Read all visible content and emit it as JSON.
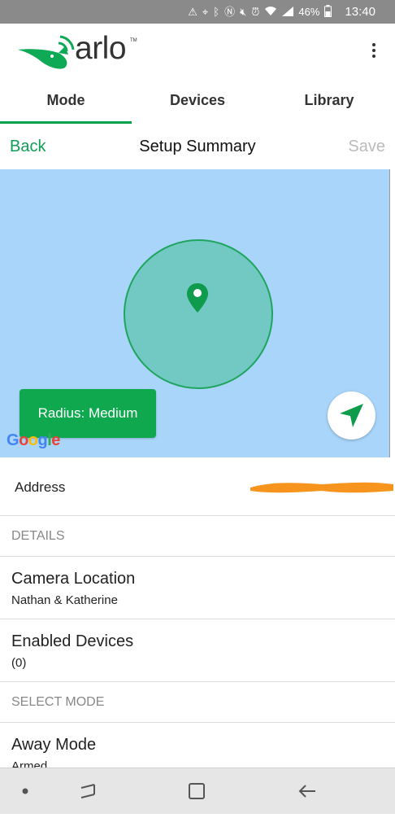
{
  "status_bar": {
    "battery_percent": "46%",
    "time": "13:40",
    "icons": [
      "warning-icon",
      "location-icon",
      "bluetooth-icon",
      "nfc-icon",
      "mute-icon",
      "alarm-icon",
      "wifi-icon",
      "signal-icon",
      "battery-icon"
    ]
  },
  "app": {
    "logo_text": "arlo",
    "logo_trademark": "TM",
    "menu_icon": "more-vert-icon",
    "brand_color": "#00a04a"
  },
  "tabs": [
    {
      "label": "Mode",
      "active": true
    },
    {
      "label": "Devices",
      "active": false
    },
    {
      "label": "Library",
      "active": false
    }
  ],
  "nav": {
    "back_label": "Back",
    "title": "Setup Summary",
    "save_label": "Save"
  },
  "map": {
    "radius_label": "Radius: Medium",
    "google_label": "Google",
    "locate_icon": "navigation-arrow-icon",
    "pin_icon": "location-pin-icon",
    "water_color": "#a8d5f9",
    "geofence_color": "#72c8c2"
  },
  "address": {
    "label": "Address"
  },
  "details_section": {
    "header": "DETAILS",
    "items": [
      {
        "title": "Camera Location",
        "subtitle": "Nathan & Katherine"
      },
      {
        "title": "Enabled Devices",
        "subtitle": "(0)"
      }
    ]
  },
  "mode_section": {
    "header": "SELECT MODE",
    "items": [
      {
        "title": "Away Mode",
        "subtitle": "Armed"
      }
    ]
  },
  "system_nav": {
    "icons": [
      "dot-icon",
      "recents-icon",
      "home-icon",
      "back-icon"
    ]
  }
}
